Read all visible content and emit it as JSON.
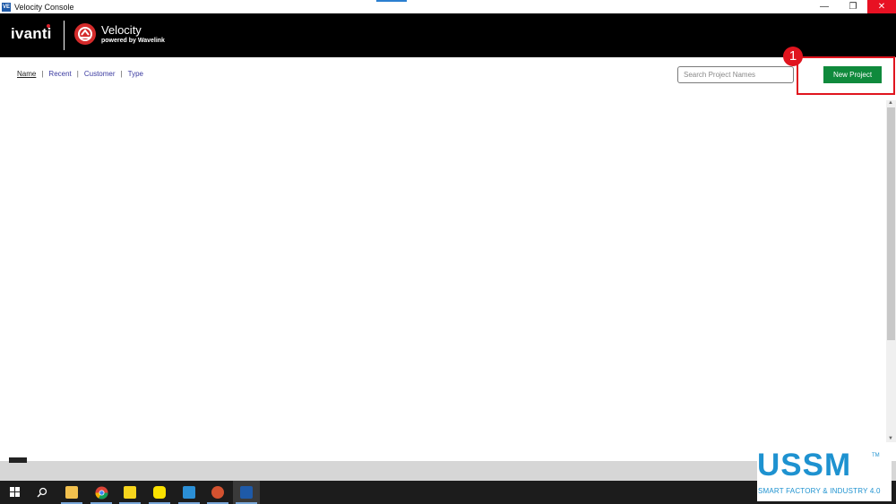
{
  "window": {
    "app_icon": "VE",
    "title": "Velocity Console",
    "minimize_glyph": "—",
    "maximize_glyph": "❐",
    "close_glyph": "✕"
  },
  "header": {
    "brand": "ivanti",
    "product": "Velocity",
    "subtitle": "powered by Wavelink",
    "background_color": "#000000"
  },
  "sort": {
    "links": [
      "Name",
      "Recent",
      "Customer",
      "Type"
    ],
    "separator": "|",
    "active": "Name"
  },
  "search": {
    "placeholder": "Search Project Names",
    "value": ""
  },
  "new_project": {
    "label": "New Project",
    "color": "#0f8a3c"
  },
  "annotation": {
    "step": "1",
    "color": "#e0141e"
  },
  "taskbar": {
    "items": [
      "windows-start-icon",
      "search-icon",
      "file-explorer-icon",
      "chrome-icon",
      "sticky-notes-icon",
      "kakaotalk-icon",
      "outlook-icon",
      "powerpoint-icon",
      "velocity-icon"
    ]
  },
  "watermark": {
    "logo": "USSM",
    "trademark": "TM",
    "tagline": "SMART FACTORY & INDUSTRY 4.0"
  }
}
